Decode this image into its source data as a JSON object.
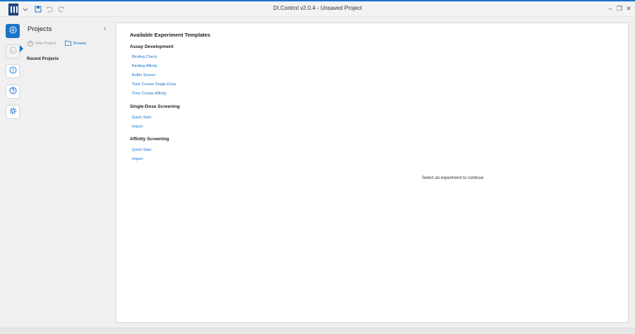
{
  "window": {
    "title": "DI.Control v2.0.4 - Unsaved Project",
    "accent_color": "#1a73c8"
  },
  "titlebar_icons": [
    "app-logo-icon",
    "chevron-down-icon",
    "save-icon",
    "undo-icon",
    "redo-icon"
  ],
  "window_controls": [
    "minimize-icon",
    "restore-icon",
    "close-icon"
  ],
  "rail": {
    "items": [
      {
        "name": "projects",
        "icon": "projects-icon",
        "active": true
      },
      {
        "name": "experiment",
        "icon": "experiment-icon",
        "active": false
      },
      {
        "name": "info",
        "icon": "info-icon",
        "active": false
      },
      {
        "name": "help",
        "icon": "help-icon",
        "active": false
      },
      {
        "name": "settings",
        "icon": "gear-icon",
        "active": false
      }
    ]
  },
  "projects_panel": {
    "title": "Projects",
    "new_project_label": "New Project",
    "browse_label": "Browse",
    "recent_label": "Recent Projects"
  },
  "main": {
    "title": "Available Experiment Templates",
    "sections": [
      {
        "title": "Assay Development",
        "items": [
          "Binding Check",
          "Binding Affinity",
          "Buffer Screen",
          "Time Course Single-Dose",
          "Time Course Affinity"
        ]
      },
      {
        "title": "Single-Dose Screening",
        "items": [
          "Quick Start",
          "Import"
        ]
      },
      {
        "title": "Affinity Screening",
        "items": [
          "Quick-Start",
          "Import"
        ]
      }
    ],
    "hint": "Select an experiment to continue"
  }
}
